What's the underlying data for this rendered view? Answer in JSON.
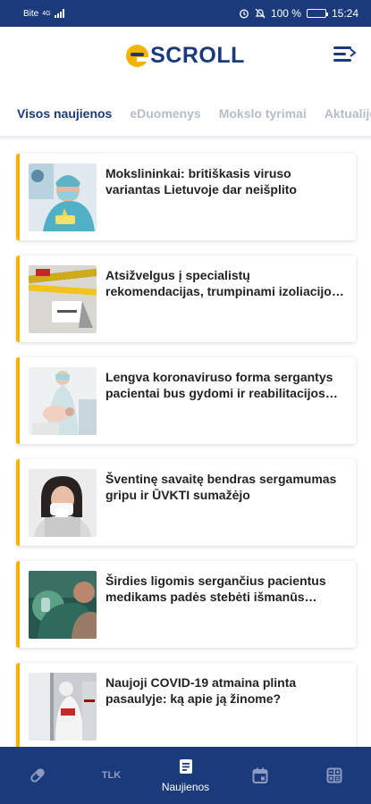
{
  "status_bar": {
    "carrier": "Bite",
    "network": "4G",
    "battery": "100 %",
    "time": "15:24"
  },
  "header": {
    "logo_text": "SCROLL",
    "menu_icon": "menu-icon"
  },
  "tabs": [
    {
      "label": "Visos naujienos",
      "active": true
    },
    {
      "label": "eDuomenys",
      "active": false
    },
    {
      "label": "Mokslo tyrimai",
      "active": false
    },
    {
      "label": "Aktualijos",
      "active": false
    }
  ],
  "articles": [
    {
      "title": "Mokslininkai: britiškasis viruso variantas Lietuvoje dar neišplito"
    },
    {
      "title": "Atsižvelgus į specialistų rekomendacijas, trumpinami izoliacijos laikotarpiai"
    },
    {
      "title": "Lengva koronaviruso forma sergantys pacientai bus gydomi ir reabilitacijos centruose"
    },
    {
      "title": "Šventinę savaitę bendras sergamumas gripu ir ŪVKTI sumažėjo"
    },
    {
      "title": "Širdies ligomis sergančius pacientus medikams padės stebėti išmanūs matuokliai"
    },
    {
      "title": "Naujoji COVID-19 atmaina plinta pasaulyje: ką apie ją žinome?"
    }
  ],
  "bottom_nav": [
    {
      "icon": "pill-icon",
      "label": ""
    },
    {
      "icon": "tlk-icon",
      "label": "TLK"
    },
    {
      "icon": "news-icon",
      "label": "Naujienos",
      "active": true
    },
    {
      "icon": "calendar-icon",
      "label": ""
    },
    {
      "icon": "calculator-icon",
      "label": ""
    }
  ],
  "colors": {
    "brand_blue": "#1b3a7b",
    "accent_yellow": "#f4b300"
  }
}
